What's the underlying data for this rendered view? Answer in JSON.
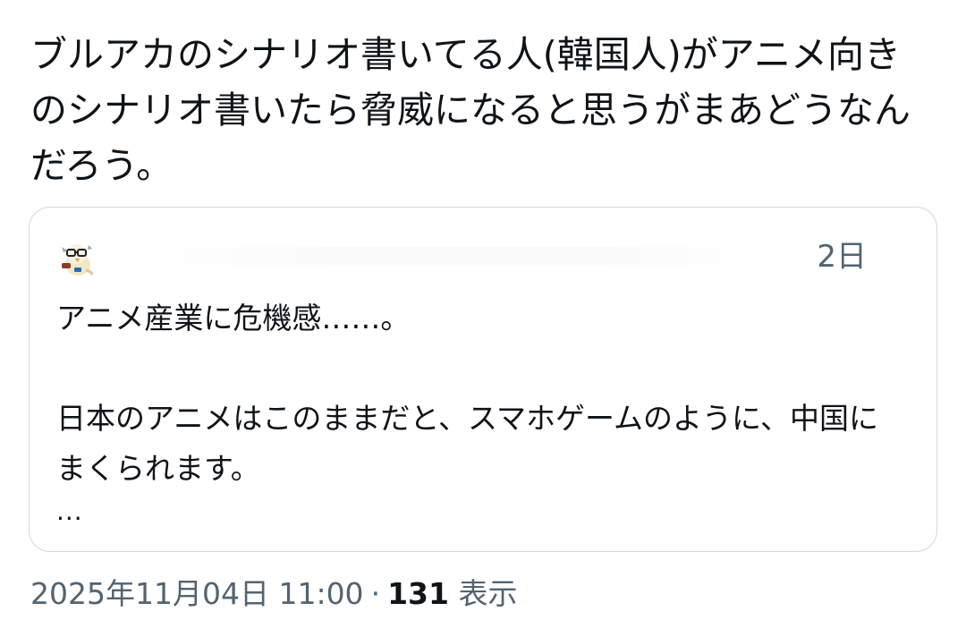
{
  "tweet": {
    "text": "ブルアカのシナリオ書いてる人(韓国人)がアニメ向きのシナリオ書いたら脅威になると思うがまあどうなんだろう。"
  },
  "quote": {
    "time": "2日",
    "avatar_icon": "cartoon-bird-avatar-icon",
    "lines": {
      "line1": "アニメ産業に危機感……。",
      "line2": "日本のアニメはこのままだと、スマホゲームのように、中国にまくられます。",
      "line3": "..."
    }
  },
  "meta": {
    "timestamp": "2025年11月04日 11:00",
    "separator": "·",
    "views_count": "131",
    "views_label": "表示"
  },
  "colors": {
    "text": "#0f1419",
    "secondary": "#536471",
    "border": "#cfd9de"
  }
}
